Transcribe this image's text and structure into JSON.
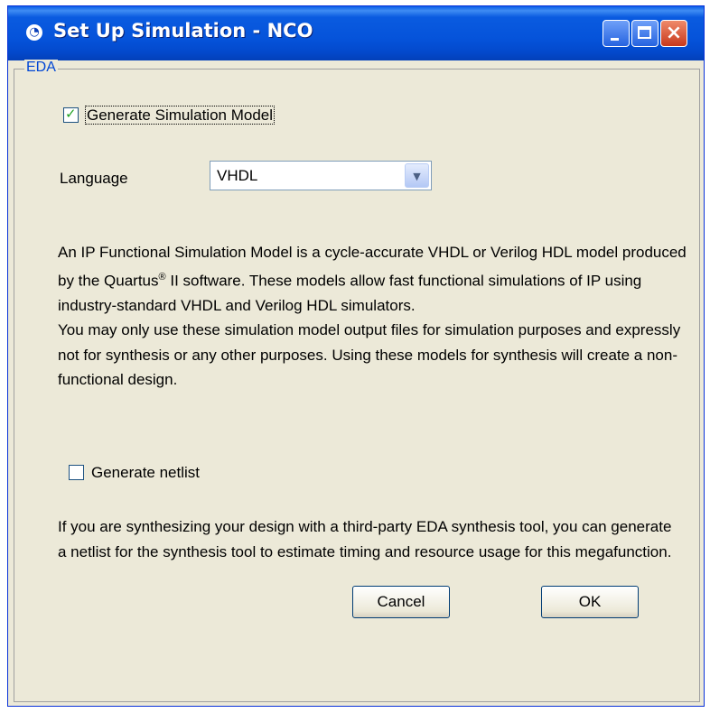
{
  "window": {
    "title": "Set Up Simulation - NCO",
    "app_icon": "◔",
    "controls": {
      "minimize": "minimize-icon",
      "maximize": "maximize-icon",
      "close": "×"
    }
  },
  "group": {
    "label": "EDA"
  },
  "generate_model": {
    "label": "Generate Simulation Model",
    "checked": true,
    "check_mark": "✓"
  },
  "language": {
    "label": "Language",
    "value": "VHDL",
    "arrow": "▼"
  },
  "description": {
    "line1_pre": "An IP Functional Simulation Model is a cycle-accurate VHDL or Verilog HDL model produced by the Quartus",
    "registered": "®",
    "line1_post": " II software. These models allow fast functional simulations of IP using industry-standard VHDL and Verilog HDL simulators.",
    "line2": "You may only use these simulation model output files for simulation purposes and expressly not for synthesis or any other purposes. Using these models for synthesis will create a non-functional design."
  },
  "generate_netlist": {
    "label": "Generate netlist",
    "checked": false
  },
  "netlist_description": "If you are synthesizing your design with a third-party EDA synthesis tool, you can generate a netlist for the synthesis tool to estimate timing and resource usage for this megafunction.",
  "buttons": {
    "cancel": "Cancel",
    "ok": "OK"
  },
  "colors": {
    "title_bar": "#0553da",
    "dialog_bg": "#ece9d8",
    "group_label": "#0046d5",
    "check": "#21a121"
  }
}
